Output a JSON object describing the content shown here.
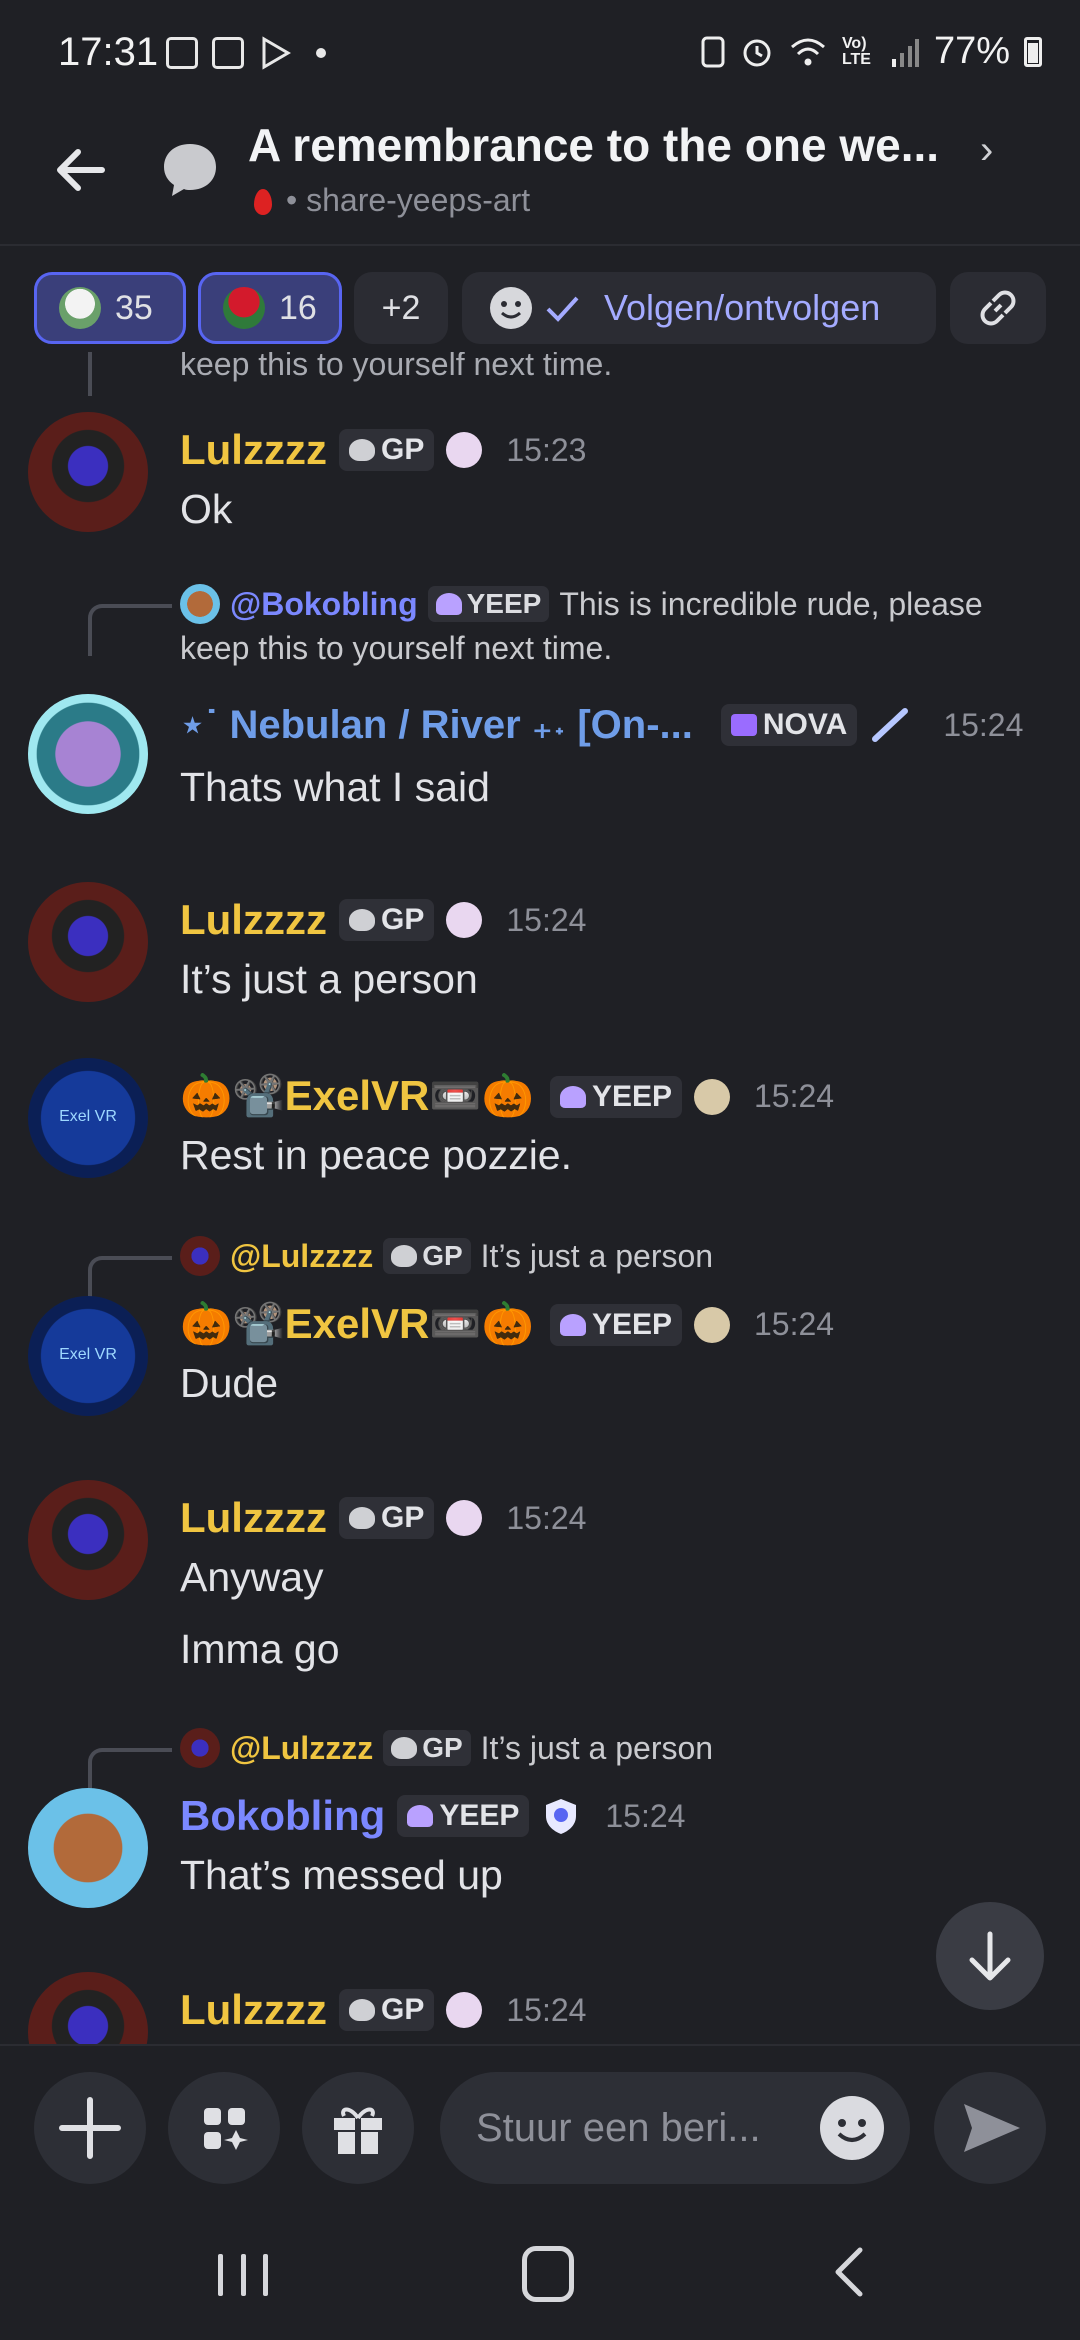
{
  "status": {
    "time": "17:31",
    "signal_label": "Vo) LTE",
    "battery": "77%"
  },
  "header": {
    "title": "A remembrance to the one we...",
    "channel": "• share-yeeps-art"
  },
  "reactions": [
    {
      "emoji": "dove",
      "count": "35"
    },
    {
      "emoji": "rose",
      "count": "16"
    },
    {
      "more": "+2"
    }
  ],
  "follow_label": "Volgen/ontvolgen",
  "messages": {
    "cut_text": "keep this to yourself next time.",
    "m1": {
      "name": "Lulzzzz",
      "tag": "GP",
      "time": "15:23",
      "lines": [
        "Ok"
      ]
    },
    "m2": {
      "reply": {
        "name": "@Bokobling",
        "tag": "YEEP",
        "text": "This is incredible rude, please",
        "text2": "keep this to yourself next time."
      },
      "name": "⋆˙ Nebulan / River ₊˖ [On-...",
      "tag": "NOVA",
      "time": "15:24",
      "lines": [
        "Thats what I said"
      ]
    },
    "m3": {
      "name": "Lulzzzz",
      "tag": "GP",
      "time": "15:24",
      "lines": [
        "It’s just a person"
      ]
    },
    "m4": {
      "name": "🎃📽️ExelVR📼🎃",
      "tag": "YEEP",
      "time": "15:24",
      "lines": [
        "Rest in peace pozzie."
      ],
      "avatar_text": "Exel VR"
    },
    "m5": {
      "reply": {
        "name": "@Lulzzzz",
        "tag": "GP",
        "text": "It’s just a person"
      },
      "name": "🎃📽️ExelVR📼🎃",
      "tag": "YEEP",
      "time": "15:24",
      "lines": [
        "Dude"
      ],
      "avatar_text": "Exel VR"
    },
    "m6": {
      "name": "Lulzzzz",
      "tag": "GP",
      "time": "15:24",
      "lines": [
        "Anyway",
        "Imma go"
      ]
    },
    "m7": {
      "reply": {
        "name": "@Lulzzzz",
        "tag": "GP",
        "text": "It’s just a person"
      },
      "name": "Bokobling",
      "tag": "YEEP",
      "time": "15:24",
      "lines": [
        "That’s messed up"
      ]
    },
    "m8": {
      "name": "Lulzzzz",
      "tag": "GP",
      "time": "15:24"
    }
  },
  "composer": {
    "placeholder": "Stuur een beri..."
  },
  "colors": {
    "accent": "#5865f2",
    "gold_name": "#f0c541",
    "background": "#1f2025"
  }
}
